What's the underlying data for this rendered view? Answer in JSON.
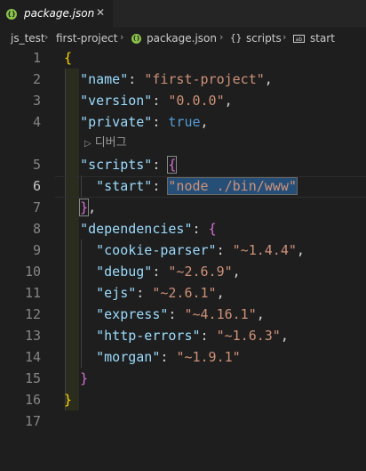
{
  "tab": {
    "label": "package.json",
    "icon": "json-file-icon",
    "close": "✕"
  },
  "breadcrumb": {
    "items": [
      "js_test",
      "first-project",
      "package.json",
      "scripts",
      "start"
    ]
  },
  "codelens": {
    "label": "디버그"
  },
  "lines": [
    {
      "n": "1",
      "html": "<span class='br1'>{</span>"
    },
    {
      "n": "2",
      "html": "  <span class='k'>\"name\"</span><span class='p'>: </span><span class='s'>\"first-project\"</span><span class='p'>,</span>"
    },
    {
      "n": "3",
      "html": "  <span class='k'>\"version\"</span><span class='p'>: </span><span class='s'>\"0.0.0\"</span><span class='p'>,</span>"
    },
    {
      "n": "4",
      "html": "  <span class='k'>\"private\"</span><span class='p'>: </span><span class='b'>true</span><span class='p'>,</span>"
    },
    {
      "n": "5",
      "html": "  <span class='k'>\"scripts\"</span><span class='p'>: </span><span class='br2 match'>{</span>"
    },
    {
      "n": "6",
      "html": "    <span class='k'>\"start\"</span><span class='p'>: </span><span class='s sel-str'>\"node ./bin/www\"</span>"
    },
    {
      "n": "7",
      "html": "  <span class='br2 match'>}</span><span class='p'>,</span>"
    },
    {
      "n": "8",
      "html": "  <span class='k'>\"dependencies\"</span><span class='p'>: </span><span class='br2'>{</span>"
    },
    {
      "n": "9",
      "html": "    <span class='k'>\"cookie-parser\"</span><span class='p'>: </span><span class='s'>\"~1.4.4\"</span><span class='p'>,</span>"
    },
    {
      "n": "10",
      "html": "    <span class='k'>\"debug\"</span><span class='p'>: </span><span class='s'>\"~2.6.9\"</span><span class='p'>,</span>"
    },
    {
      "n": "11",
      "html": "    <span class='k'>\"ejs\"</span><span class='p'>: </span><span class='s'>\"~2.6.1\"</span><span class='p'>,</span>"
    },
    {
      "n": "12",
      "html": "    <span class='k'>\"express\"</span><span class='p'>: </span><span class='s'>\"~4.16.1\"</span><span class='p'>,</span>"
    },
    {
      "n": "13",
      "html": "    <span class='k'>\"http-errors\"</span><span class='p'>: </span><span class='s'>\"~1.6.3\"</span><span class='p'>,</span>"
    },
    {
      "n": "14",
      "html": "    <span class='k'>\"morgan\"</span><span class='p'>: </span><span class='s'>\"~1.9.1\"</span>"
    },
    {
      "n": "15",
      "html": "  <span class='br2'>}</span>"
    },
    {
      "n": "16",
      "html": "<span class='br1'>}</span>"
    },
    {
      "n": "17",
      "html": ""
    }
  ],
  "active_line": "6"
}
